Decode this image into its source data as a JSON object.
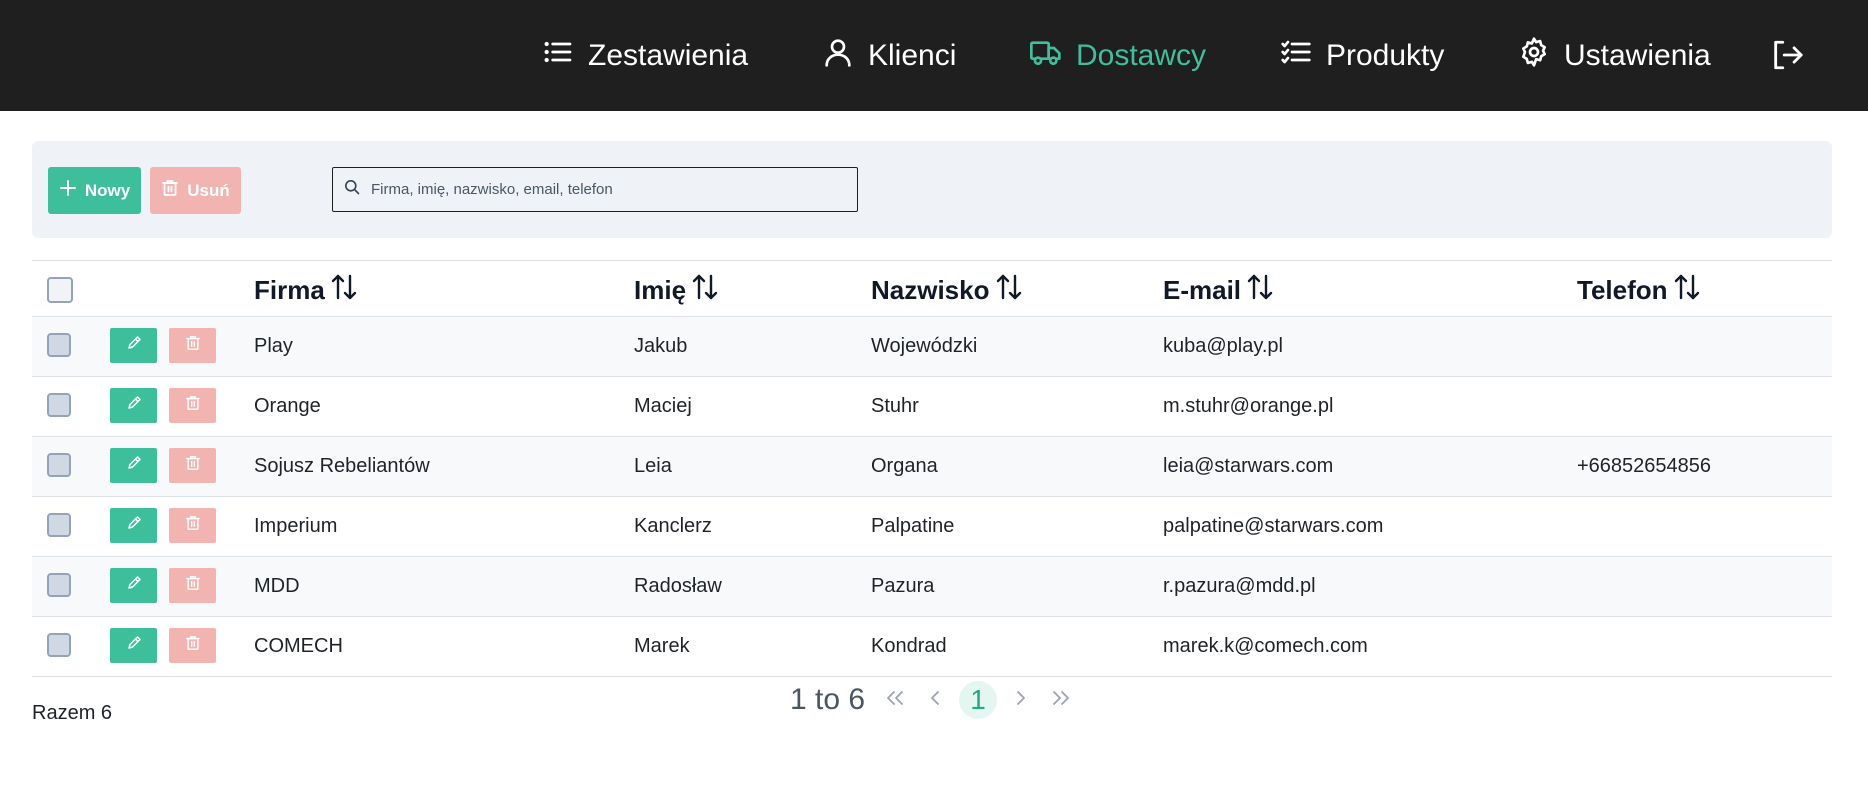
{
  "nav": {
    "items": [
      {
        "label": "Zestawienia",
        "icon": "list-icon",
        "active": false
      },
      {
        "label": "Klienci",
        "icon": "user-icon",
        "active": false
      },
      {
        "label": "Dostawcy",
        "icon": "truck-icon",
        "active": true
      },
      {
        "label": "Produkty",
        "icon": "checklist-icon",
        "active": false
      },
      {
        "label": "Ustawienia",
        "icon": "gear-icon",
        "active": false
      }
    ],
    "logout_icon": "logout-icon"
  },
  "toolbar": {
    "new_label": "Nowy",
    "delete_label": "Usuń",
    "search_placeholder": "Firma, imię, nazwisko, email, telefon",
    "search_value": ""
  },
  "table": {
    "columns": [
      "Firma",
      "Imię",
      "Nazwisko",
      "E-mail",
      "Telefon"
    ],
    "rows": [
      {
        "firma": "Play",
        "imie": "Jakub",
        "nazwisko": "Wojewódzki",
        "email": "kuba@play.pl",
        "telefon": ""
      },
      {
        "firma": "Orange",
        "imie": "Maciej",
        "nazwisko": "Stuhr",
        "email": "m.stuhr@orange.pl",
        "telefon": ""
      },
      {
        "firma": "Sojusz Rebeliantów",
        "imie": "Leia",
        "nazwisko": "Organa",
        "email": "leia@starwars.com",
        "telefon": "+66852654856"
      },
      {
        "firma": "Imperium",
        "imie": "Kanclerz",
        "nazwisko": "Palpatine",
        "email": "palpatine@starwars.com",
        "telefon": ""
      },
      {
        "firma": "MDD",
        "imie": "Radosław",
        "nazwisko": "Pazura",
        "email": "r.pazura@mdd.pl",
        "telefon": ""
      },
      {
        "firma": "COMECH",
        "imie": "Marek",
        "nazwisko": "Kondrad",
        "email": "marek.k@comech.com",
        "telefon": ""
      }
    ]
  },
  "footer": {
    "total": "Razem 6",
    "range": "1 to 6",
    "current_page": "1"
  },
  "colors": {
    "nav_bg": "#1f1f1f",
    "accent": "#3ebf9c",
    "danger_soft": "#f2b4b0"
  }
}
